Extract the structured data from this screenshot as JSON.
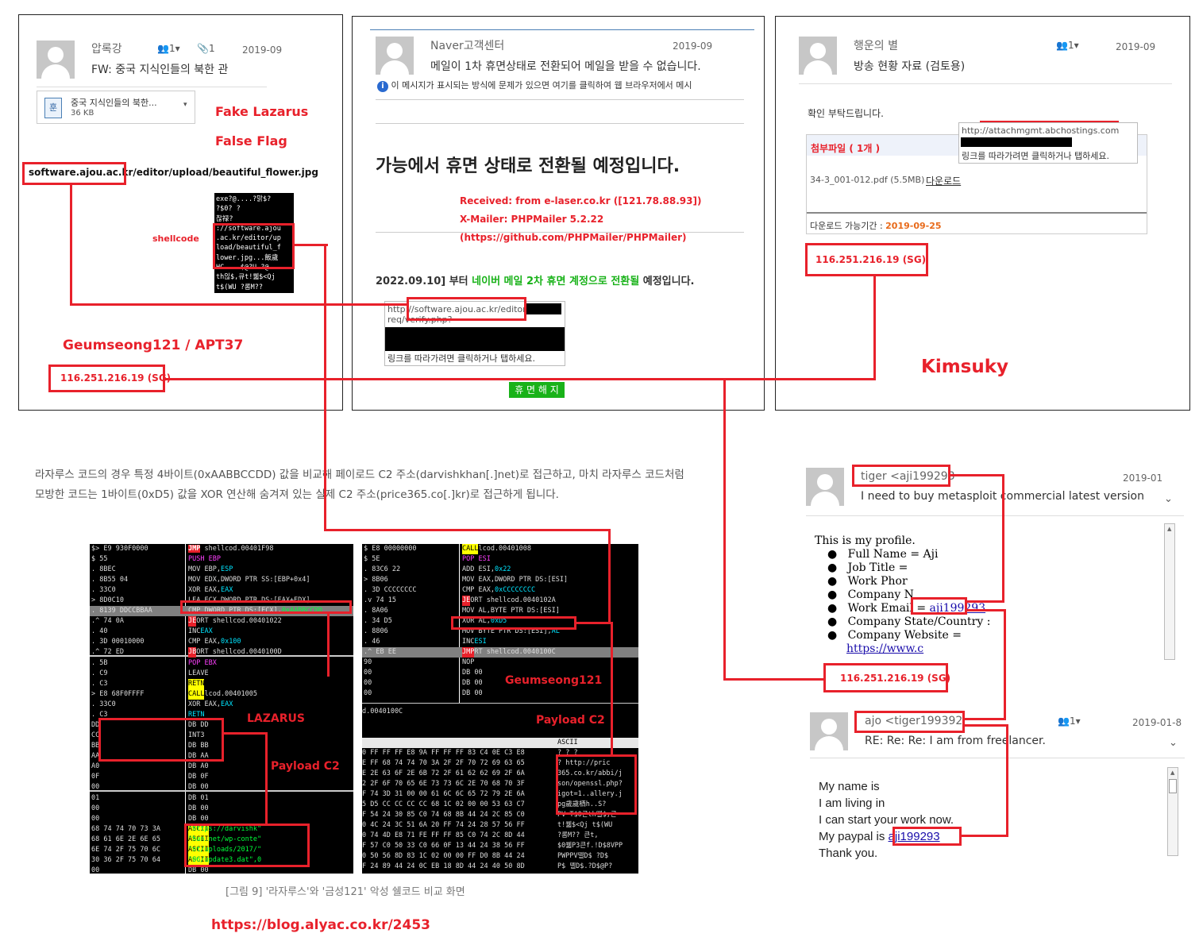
{
  "panel_left": {
    "sender": "압록강",
    "people_count": "1",
    "attach_count": "1",
    "date": "2019-09",
    "subject": "FW: 중국 지식인들의 북한 관",
    "attachment_name": "중국 지식인들의 북한...",
    "attachment_size": "36 KB",
    "fake_lazarus": "Fake Lazarus",
    "false_flag": "False Flag",
    "url_host": "software.ajou.ac.kr",
    "url_path": "/editor/upload/beautiful_flower.jpg",
    "shellcode_label": "shellcode",
    "hex_lines": [
      "exe?@....?맑$?",
      "?$0?      ?",
      "      찮禄?",
      "://software.ajou",
      ".ac.kr/editor/up",
      "load/beautiful_f",
      "lower.jpg...飯歲",
      "HC....$@?U  ?@",
      "th읺$,큐t!쒧$<Qj",
      "   t$(WU  ?롬M??"
    ],
    "actor_label": "Geumseong121 / APT37",
    "ip": "116.251.216.19 (SG)"
  },
  "panel_mid": {
    "sender": "Naver고객센터",
    "date": "2019-09",
    "subject": "메일이 1차 휴면상태로 전환되어 메일을 받을 수 없습니다.",
    "info_text": "이 메시지가 표시되는 방식에 문제가 있으면 여기를 클릭하여 웹 브라우저에서 메시",
    "headline": "가능에서 휴면 상태로 전환될 예정입니다.",
    "received": "Received: from e-laser.co.kr ([121.78.88.93])",
    "xmailer": "X-Mailer: PHPMailer 5.2.22",
    "github": "(https://github.com/PHPMailer/PHPMailer)",
    "notice_prefix": "2022.09.10] 부터 ",
    "notice_green": "네이버 메일 2차 휴면 계정으로 전환될",
    "notice_suffix": " 예정입니다.",
    "tooltip_url": "http://software.ajou.ac.kr/editor",
    "tooltip_url2": "req/verify.php?",
    "tooltip_hint": "링크를 따라가려면 클릭하거나 탭하세요.",
    "green_button": "휴 면 해 지"
  },
  "panel_right": {
    "sender": "행운의 별",
    "people_count": "1",
    "date": "2019-09",
    "subject": "방송 현황 자료 (검토용)",
    "body": "확인 부탁드립니다.",
    "tooltip_url": "http://attachmgmt.abchostings.com",
    "tooltip_hint": "링크를 따라가려면 클릭하거나 탭하세요.",
    "attach_header": "첨부파일 ( 1개 )",
    "file": "34-3_001-012.pdf (5.5MB)",
    "download": "다운로드",
    "period_label": "다운로드 가능기간 : ",
    "period_date": "2019-09-25",
    "ip": "116.251.216.19 (SG)",
    "actor_label": "Kimsuky"
  },
  "article": {
    "para": "라자루스 코드의 경우 특정 4바이트(0xAABBCCDD) 값을 비교해 페이로드 C2 주소(darvishkhan[.]net)로 접근하고, 마치 라자루스 코드처럼 모방한 코드는 1바이트(0xD5) 값을 XOR 연산해 숨겨져 있는 실제 C2 주소(price365.co[.]kr)로 접근하게 됩니다.",
    "caption": "[그림 9] '라자루스'와 '금성121' 악성 쉘코드 비교 화면",
    "source_url": "https://blog.alyac.co.kr/2453"
  },
  "dbg_left": {
    "label_lazarus": "LAZARUS",
    "label_payload": "Payload C2"
  },
  "dbg_right": {
    "label_actor": "Geumseong121",
    "label_payload": "Payload C2",
    "status": "d.0040100C",
    "col_ascii": "ASCII"
  },
  "email_tiger": {
    "sender": "tiger <aji199293",
    "date": "2019-01",
    "subject": "I need to buy metasploit commercial latest version",
    "intro": "This is my profile.",
    "items": [
      "Full Name = Aji",
      "Job Title =",
      "Work Phor",
      "Company N",
      "Work Email = ",
      "Company State/Country :",
      "Company Website ="
    ],
    "work_email_link": "aji199293",
    "website_link": "https://www.c",
    "ip": "116.251.216.19 (SG)"
  },
  "email_ajo": {
    "sender": "ajo <tiger199392",
    "people_count": "1",
    "date": "2019-01-8",
    "subject": "RE: Re: Re: I am from freelancer.",
    "lines": [
      "My name is",
      "I am living in",
      "I can start your work now.",
      "My paypal is "
    ],
    "paypal_link": "aji199293",
    "closing": "Thank you."
  },
  "colors": {
    "accent_red": "#e8212b",
    "green_button": "#19b219",
    "link_blue": "#1a0dab"
  }
}
